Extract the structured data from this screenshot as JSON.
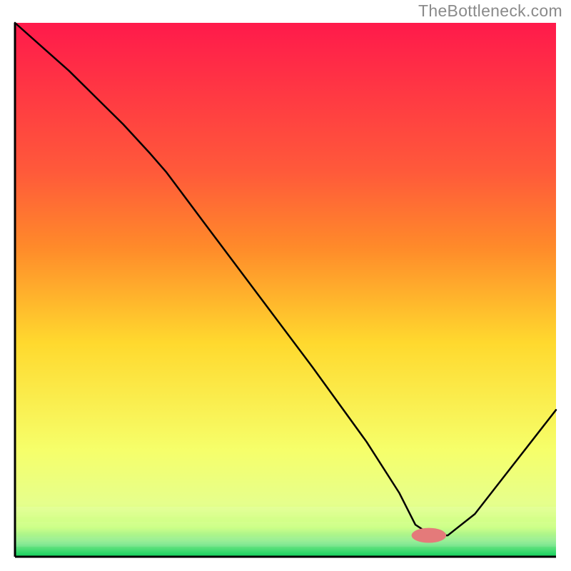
{
  "watermark": "TheBottleneck.com",
  "chart_data": {
    "type": "line",
    "title": "",
    "xlabel": "",
    "ylabel": "",
    "xlim": [
      0,
      100
    ],
    "ylim": [
      0,
      100
    ],
    "axis_visible": {
      "x": true,
      "y": true,
      "ticks": false,
      "labels": false
    },
    "grid": false,
    "legend": false,
    "background_gradient": {
      "top": "#ff1a4b",
      "mid_upper": "#ff8a2a",
      "mid": "#ffd92e",
      "mid_lower": "#f6ff6a",
      "near_bottom": "#c7ff7a",
      "bottom": "#10d05c"
    },
    "bottom_stripes_rgba": [
      "rgba(255,255,255,0.12)",
      "rgba(255,255,255,0.10)",
      "rgba(255,255,255,0.08)"
    ],
    "marker": {
      "x": 76.5,
      "y": 4.0,
      "rx": 3.2,
      "ry": 1.4,
      "fill": "#e47a7a"
    },
    "series": [
      {
        "name": "curve",
        "x": [
          0.0,
          5.0,
          10.0,
          15.0,
          20.0,
          25.0,
          28.0,
          35.0,
          45.0,
          55.0,
          65.0,
          71.0,
          74.0,
          77.0,
          80.0,
          85.0,
          90.0,
          95.0,
          100.0
        ],
        "y": [
          100.0,
          95.5,
          91.0,
          86.0,
          81.0,
          75.5,
          72.0,
          62.5,
          49.0,
          35.5,
          21.5,
          12.0,
          6.0,
          4.0,
          4.0,
          8.0,
          14.5,
          21.0,
          27.5
        ]
      }
    ]
  }
}
